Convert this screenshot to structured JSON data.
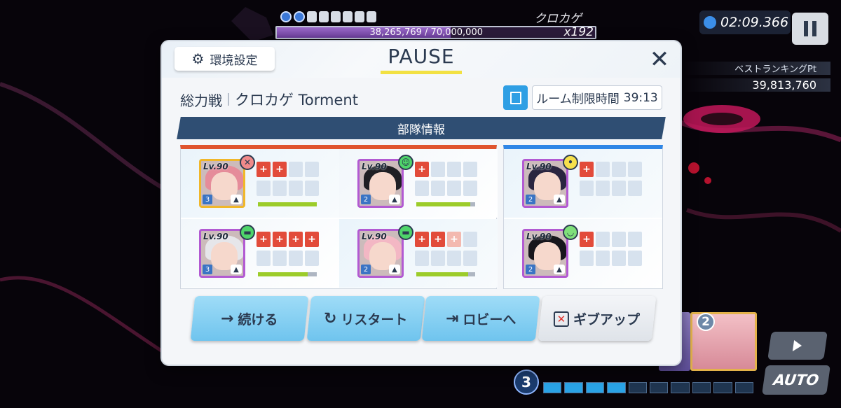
{
  "hud": {
    "boss_name": "クロカゲ",
    "boss_hp_text": "38,265,769 / 70,000,000",
    "boss_hp_fraction": 0.547,
    "hp_multiplier": "x192",
    "timer": "02:09.366",
    "ranking_label": "ベストランキングPt",
    "ranking_value": "39,813,760",
    "auto_label": "AUTO",
    "cost_value": "3",
    "skill_card_cost": "2"
  },
  "modal": {
    "settings_label": "環境設定",
    "title": "PAUSE",
    "raid_type": "総力戦",
    "raid_name": "クロカゲ Torment",
    "room_limit_label": "ルーム制限時間",
    "room_limit_time": "39:13",
    "team_banner": "部隊情報",
    "strikers": [
      {
        "level": "Lv.90",
        "stars": "3",
        "mood": "angry",
        "hp": 1.0,
        "hair": "#e58c9a"
      },
      {
        "level": "Lv.90",
        "stars": "2",
        "mood": "happy",
        "hp": 0.92,
        "hair": "#1f1f24"
      },
      {
        "level": "Lv.90",
        "stars": "3",
        "mood": "cool",
        "hp": 0.85,
        "hair": "#e6e6ea"
      },
      {
        "level": "Lv.90",
        "stars": "2",
        "mood": "cool",
        "hp": 0.88,
        "hair": "#f3b7c4"
      }
    ],
    "specials": [
      {
        "level": "Lv.90",
        "stars": "2",
        "mood": "neutral",
        "hair": "#2a2540"
      },
      {
        "level": "Lv.90",
        "stars": "2",
        "mood": "smile",
        "hair": "#17161c"
      }
    ],
    "buttons": {
      "continue": "続ける",
      "restart": "リスタート",
      "lobby": "ロビーへ",
      "give_up": "ギブアップ"
    }
  },
  "colors": {
    "striker_accent": "#e0542e",
    "special_accent": "#2f86e6",
    "banner": "#2f4e73",
    "title_underline": "#f2e143",
    "button_blue": "#6fc4ee"
  }
}
